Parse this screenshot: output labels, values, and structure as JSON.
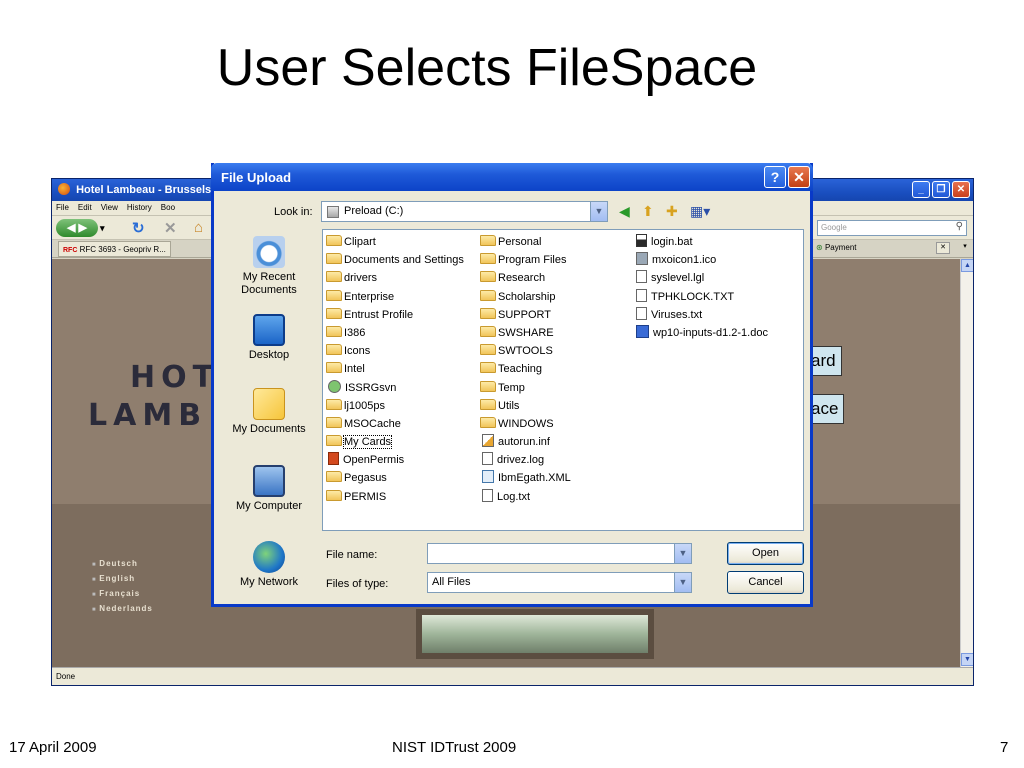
{
  "slide": {
    "title": "User Selects FileSpace",
    "footer_date": "17 April 2009",
    "footer_center": "NIST IDTrust 2009",
    "footer_page": "7"
  },
  "browser": {
    "title": "Hotel Lambeau - Brussels",
    "menu": [
      "File",
      "Edit",
      "View",
      "History",
      "Boo"
    ],
    "search_placeholder": "Google",
    "tab_rfc": "RFC",
    "tab_label": "RFC 3693 - Geopriv R...",
    "payment_tab": "Payment",
    "status": "Done",
    "icons": {
      "back": "back-arrow-icon",
      "forward": "forward-arrow-icon",
      "reload": "reload-icon",
      "stop": "stop-icon",
      "home": "home-icon",
      "search": "magnifier-icon"
    }
  },
  "page": {
    "logo_line1": "HOT",
    "logo_line2": "LAMB",
    "languages": [
      "Deutsch",
      "English",
      "Français",
      "Nederlands"
    ],
    "button1_text": "ard",
    "button2_text": "ace"
  },
  "dialog": {
    "title": "File Upload",
    "help_label": "?",
    "close_label": "✕",
    "look_in_label": "Look in:",
    "look_in_value": "Preload (C:)",
    "places": [
      "My Recent\nDocuments",
      "Desktop",
      "My Documents",
      "My Computer",
      "My Network"
    ],
    "columns": [
      [
        {
          "name": "Clipart",
          "kind": "folder"
        },
        {
          "name": "Documents and Settings",
          "kind": "folder"
        },
        {
          "name": "drivers",
          "kind": "folder"
        },
        {
          "name": "Enterprise",
          "kind": "folder"
        },
        {
          "name": "Entrust Profile",
          "kind": "folder"
        },
        {
          "name": "I386",
          "kind": "folder"
        },
        {
          "name": "Icons",
          "kind": "folder"
        },
        {
          "name": "Intel",
          "kind": "folder"
        },
        {
          "name": "ISSRGsvn",
          "kind": "svn"
        },
        {
          "name": "lj1005ps",
          "kind": "folder"
        },
        {
          "name": "MSOCache",
          "kind": "folder"
        },
        {
          "name": "My Cards",
          "kind": "folder",
          "selected": true
        },
        {
          "name": "OpenPermis",
          "kind": "openpermis"
        },
        {
          "name": "Pegasus",
          "kind": "folder"
        },
        {
          "name": "PERMIS",
          "kind": "folder"
        }
      ],
      [
        {
          "name": "Personal",
          "kind": "folder"
        },
        {
          "name": "Program Files",
          "kind": "folder"
        },
        {
          "name": "Research",
          "kind": "folder"
        },
        {
          "name": "Scholarship",
          "kind": "folder"
        },
        {
          "name": "SUPPORT",
          "kind": "folder"
        },
        {
          "name": "SWSHARE",
          "kind": "folder"
        },
        {
          "name": "SWTOOLS",
          "kind": "folder"
        },
        {
          "name": "Teaching",
          "kind": "folder"
        },
        {
          "name": "Temp",
          "kind": "folder"
        },
        {
          "name": "Utils",
          "kind": "folder"
        },
        {
          "name": "WINDOWS",
          "kind": "folder"
        },
        {
          "name": "autorun.inf",
          "kind": "inf"
        },
        {
          "name": "drivez.log",
          "kind": "file"
        },
        {
          "name": "IbmEgath.XML",
          "kind": "xml"
        },
        {
          "name": "Log.txt",
          "kind": "file"
        }
      ],
      [
        {
          "name": "login.bat",
          "kind": "bat"
        },
        {
          "name": "mxoicon1.ico",
          "kind": "ico"
        },
        {
          "name": "syslevel.lgl",
          "kind": "file"
        },
        {
          "name": "TPHKLOCK.TXT",
          "kind": "file"
        },
        {
          "name": "Viruses.txt",
          "kind": "file"
        },
        {
          "name": "wp10-inputs-d1.2-1.doc",
          "kind": "doc"
        }
      ]
    ],
    "file_name_label": "File name:",
    "file_name_value": "",
    "files_of_type_label": "Files of type:",
    "files_of_type_value": "All Files",
    "open_label": "Open",
    "cancel_label": "Cancel"
  }
}
